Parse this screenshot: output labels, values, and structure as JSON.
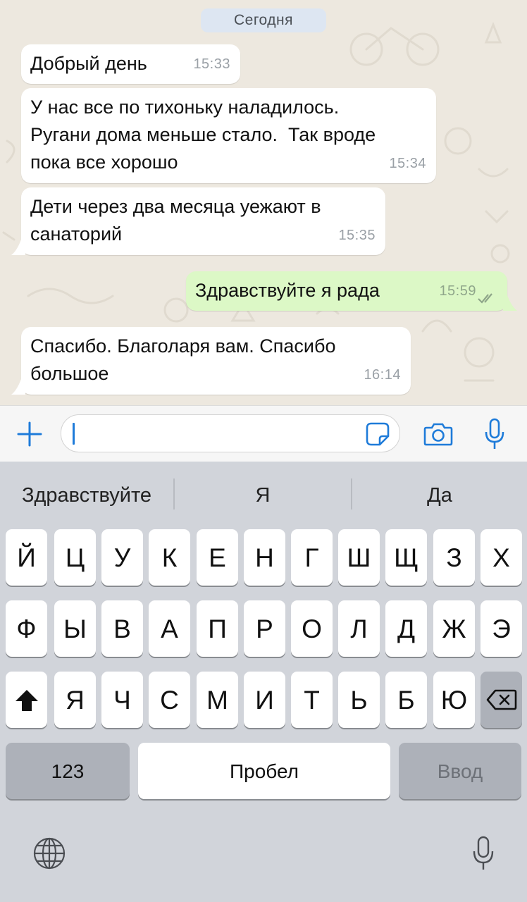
{
  "chat": {
    "date_label": "Сегодня",
    "messages": [
      {
        "direction": "in",
        "text": "Добрый день",
        "time": "15:33"
      },
      {
        "direction": "in",
        "text": "У нас все по тихоньку наладилось.\nРугани дома меньше стало.  Так вроде\nпока все хорошо",
        "time": "15:34"
      },
      {
        "direction": "in",
        "text": "Дети через два месяца уежают в\nсанаторий",
        "time": "15:35"
      },
      {
        "direction": "out",
        "text": "Здравствуйте я рада",
        "time": "15:59",
        "status": "read"
      },
      {
        "direction": "in",
        "text": "Спасибо. Благоларя вам. Спасибо\nбольшое",
        "time": "16:14"
      }
    ]
  },
  "input_bar": {
    "attach_icon": "plus-icon",
    "sticker_icon": "sticker-icon",
    "camera_icon": "camera-icon",
    "mic_icon": "microphone-icon",
    "message_value": "",
    "accent_color": "#1e7bd9"
  },
  "keyboard": {
    "suggestions": [
      "Здравствуйте",
      "Я",
      "Да"
    ],
    "row1": [
      "Й",
      "Ц",
      "У",
      "К",
      "Е",
      "Н",
      "Г",
      "Ш",
      "Щ",
      "З",
      "Х"
    ],
    "row2": [
      "Ф",
      "Ы",
      "В",
      "А",
      "П",
      "Р",
      "О",
      "Л",
      "Д",
      "Ж",
      "Э"
    ],
    "row3": [
      "Я",
      "Ч",
      "С",
      "М",
      "И",
      "Т",
      "Ь",
      "Б",
      "Ю"
    ],
    "numbers_label": "123",
    "space_label": "Пробел",
    "return_label": "Ввод",
    "shift_icon": "shift-icon",
    "backspace_icon": "backspace-icon",
    "globe_icon": "globe-icon",
    "dictation_icon": "microphone-icon"
  }
}
